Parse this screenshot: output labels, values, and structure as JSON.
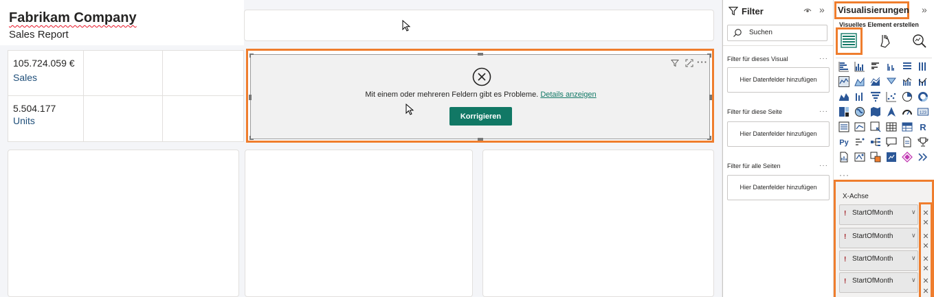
{
  "report": {
    "title": "Fabrikam Company",
    "subtitle": "Sales Report"
  },
  "kpis": [
    {
      "value": "105.724.059 €",
      "label": "Sales"
    },
    {
      "value": "5.504.177",
      "label": "Units"
    }
  ],
  "error_visual": {
    "message": "Mit einem oder mehreren Feldern gibt es Probleme.",
    "link_text": "Details anzeigen",
    "fix_button": "Korrigieren",
    "more_glyph": "···"
  },
  "filter_pane": {
    "title": "Filter",
    "collapse_glyph": "»",
    "search_placeholder": "Suchen",
    "sections": [
      {
        "title": "Filter für dieses Visual",
        "more": "···",
        "well": "Hier Datenfelder hinzufügen"
      },
      {
        "title": "Filter für diese Seite",
        "more": "···",
        "well": "Hier Datenfelder hinzufügen"
      },
      {
        "title": "Filter für alle Seiten",
        "more": "···",
        "well": "Hier Datenfelder hinzufügen"
      }
    ]
  },
  "viz_pane": {
    "title": "Visualisierungen",
    "collapse_glyph": "»",
    "subtitle": "Visuelles Element erstellen",
    "more_glyph": "···",
    "field_well_label": "X-Achse",
    "fields": [
      "StartOfMonth",
      "StartOfMonth",
      "StartOfMonth",
      "StartOfMonth"
    ],
    "warn_glyph": "!",
    "remove_glyph": "✕"
  },
  "colors": {
    "highlight": "#ef7d2d",
    "accent": "#117865",
    "kpi_label": "#1e4e79"
  }
}
